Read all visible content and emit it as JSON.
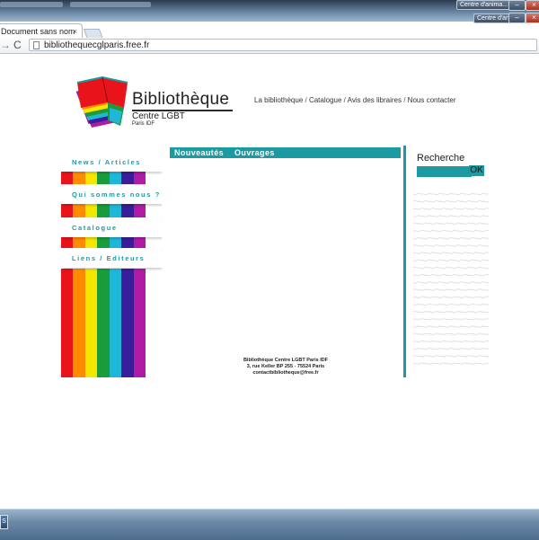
{
  "os": {
    "taskbar_button_1": "Centre d'anima...",
    "taskbar_button_2": "Centre d'anima...",
    "task_item_label": "S"
  },
  "browser": {
    "tab_title": "Document sans nom",
    "tab_close": "×",
    "url": "bibliothequecglparis.free.fr",
    "back_glyph": "→",
    "reload_glyph": "C"
  },
  "brand": {
    "title": "Bibliothèque",
    "subtitle": "Centre LGBT",
    "location": "Paris IDF"
  },
  "topnav": {
    "items": [
      "La bibliothèque",
      "Catalogue",
      "Avis des libraires",
      "Nous contacter"
    ],
    "separator": " / "
  },
  "sidebar": {
    "items": [
      {
        "label": "News / Articles"
      },
      {
        "label": "Qui sommes nous ?"
      },
      {
        "label": "Catalogue"
      },
      {
        "label": "Liens / Editeurs"
      }
    ]
  },
  "content": {
    "tabs": [
      {
        "label": "Nouveautés"
      },
      {
        "label": "Ouvrages"
      }
    ]
  },
  "search": {
    "label": "Recherche",
    "button": "OK",
    "value": ""
  },
  "footer": {
    "line1": "Bibliothèque Centre LGBT Paris IDF",
    "line2": "3, rue Keller BP 255 - 75524 Paris",
    "line3": "contactbibliotheque@free.fr"
  },
  "colors": {
    "accent": "#1b9aa1",
    "rainbow": [
      "#e8141a",
      "#ff8c00",
      "#f5e600",
      "#1a9c3a",
      "#20b6d8",
      "#3a1d9a",
      "#b01aa4"
    ]
  }
}
